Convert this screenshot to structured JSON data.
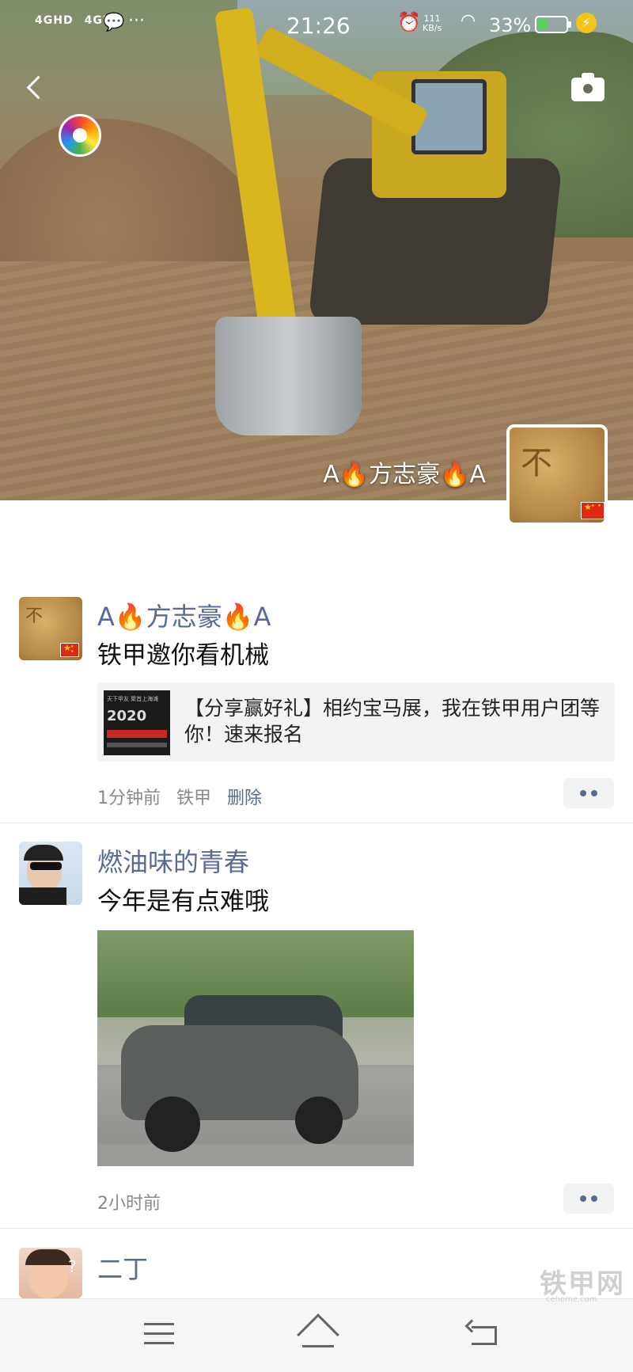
{
  "status_bar": {
    "network_1": "4GHD",
    "network_2": "4GHD",
    "time": "21:26",
    "speed_value": "111",
    "speed_unit": "KB/s",
    "battery_percent": "33%",
    "battery_level": 0.33,
    "battery_color": "#55d35a"
  },
  "header": {
    "back_icon": "chevron-left-icon",
    "camera_icon": "camera-icon",
    "aperture_icon": "aperture-icon"
  },
  "profile": {
    "name": "A🔥方志豪🔥A",
    "avatar_text": "不",
    "flag": "china-flag"
  },
  "posts": [
    {
      "name": "A🔥方志豪🔥A",
      "text": "铁甲邀你看机械",
      "share": {
        "thumb_line_1": "天下甲友 聚首上海滩",
        "thumb_line_2": "2020",
        "title": "【分享赢好礼】相约宝马展，我在铁甲用户团等你！速来报名"
      },
      "time": "1分钟前",
      "source": "铁甲",
      "delete_label": "删除"
    },
    {
      "name": "燃油味的青春",
      "text": "今年是有点难哦",
      "time": "2小时前"
    },
    {
      "name": "二丁"
    }
  ],
  "accent_colors": {
    "link": "#576b95",
    "meta": "#8a8a8a"
  },
  "watermark": {
    "title": "铁甲网",
    "sub": "cehome.com"
  }
}
